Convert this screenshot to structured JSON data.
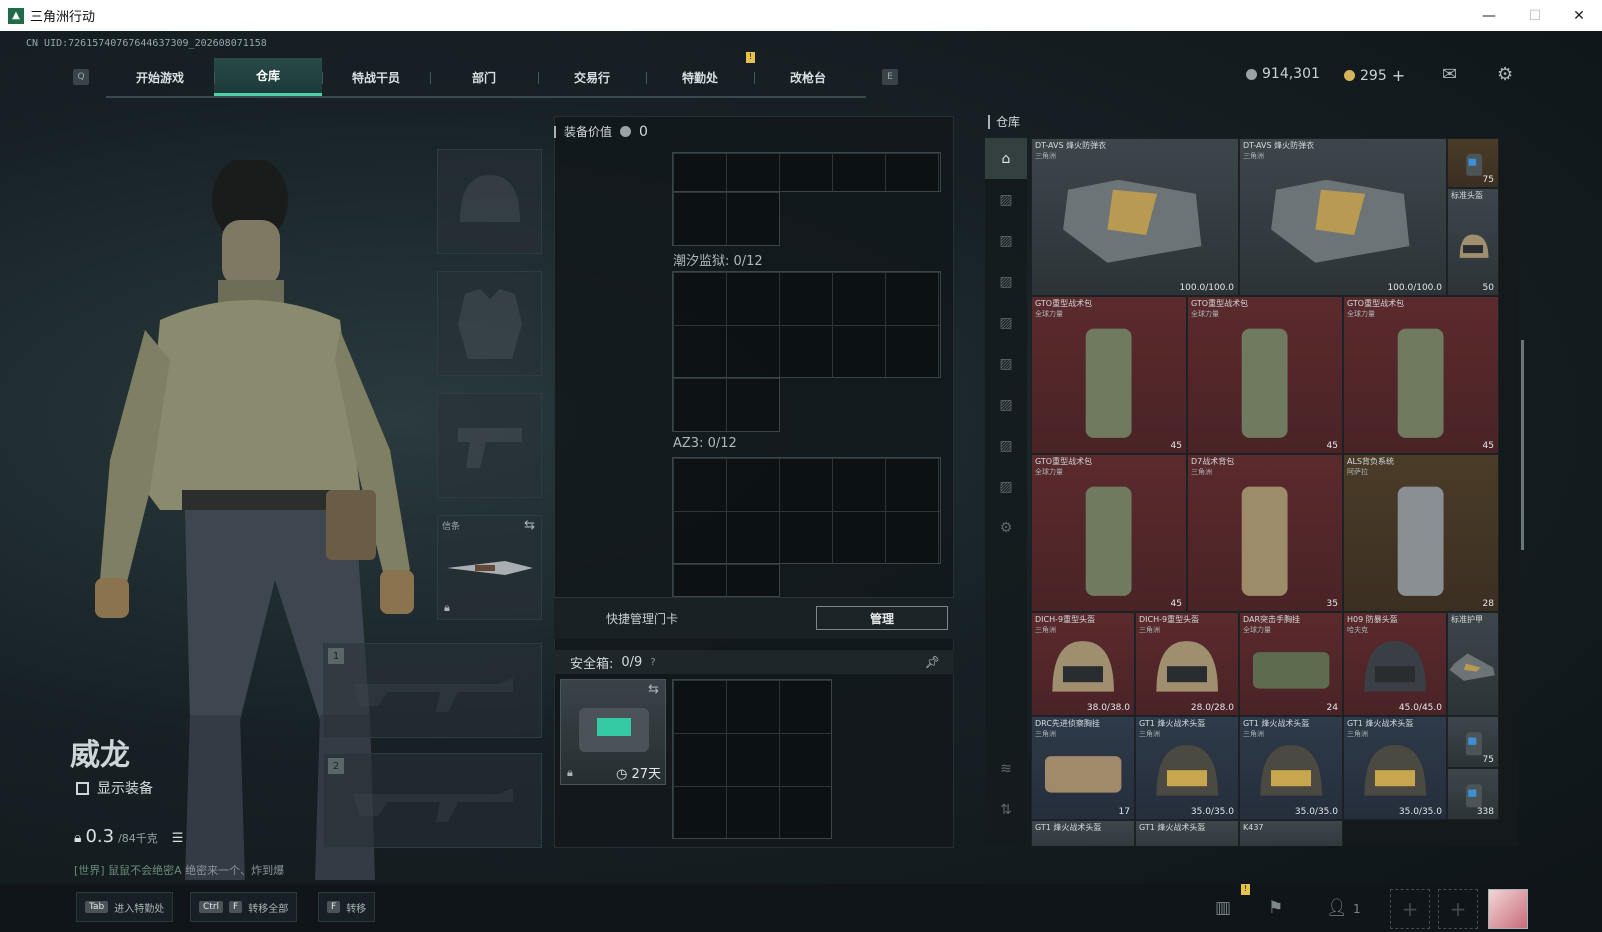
{
  "window": {
    "title": "三角洲行动",
    "minimize": "—",
    "maximize": "☐",
    "close": "✕"
  },
  "uid": "CN UID:72615740767644637309_202608071158",
  "nav": {
    "left_key": "Q",
    "right_key": "E",
    "tabs": [
      "开始游戏",
      "仓库",
      "特战干员",
      "部门",
      "交易行",
      "特勤处",
      "改枪台"
    ],
    "active_tab": "仓库"
  },
  "currency": {
    "silver": "914,301",
    "gold": "295",
    "add": "+"
  },
  "character": {
    "name": "威龙",
    "show_equipment": "显示装备",
    "weight": "0.3",
    "weight_max": "/84千克"
  },
  "chat": {
    "channel": "[世界] 鼠鼠不会绝密A",
    "message": "绝密来一个、炸到爆"
  },
  "slots": {
    "melee_label": "信条",
    "slot1": "1",
    "slot2": "2"
  },
  "middle": {
    "equip_value_label": "装备价值",
    "equip_value": "0",
    "container1": "潮汐监狱: 0/12",
    "container2": "AZ3: 0/12",
    "quick_card": "快捷管理门卡",
    "manage": "管理",
    "safe_label": "安全箱:",
    "safe_count": "0/9",
    "safe_help": "?",
    "safe_days": "27天"
  },
  "warehouse": {
    "title": "仓库",
    "items": [
      {
        "name": "DT-AVS 烽火防弹衣",
        "sub": "三角洲",
        "value": "100.0/100.0",
        "bg": "gray"
      },
      {
        "name": "DT-AVS 烽火防弹衣",
        "sub": "三角洲",
        "value": "100.0/100.0",
        "bg": "gray"
      },
      {
        "name": "",
        "sub": "",
        "value": "75",
        "bg": "gold"
      },
      {
        "name": "标准头盔",
        "sub": "",
        "value": "50",
        "bg": "gray"
      },
      {
        "name": "GTO重型战术包",
        "sub": "全球力量",
        "value": "45",
        "bg": "red"
      },
      {
        "name": "GTO重型战术包",
        "sub": "全球力量",
        "value": "45",
        "bg": "red"
      },
      {
        "name": "GTO重型战术包",
        "sub": "全球力量",
        "value": "45",
        "bg": "red"
      },
      {
        "name": "GTO重型战术包",
        "sub": "全球力量",
        "value": "45",
        "bg": "red"
      },
      {
        "name": "D7战术背包",
        "sub": "三角洲",
        "value": "35",
        "bg": "red"
      },
      {
        "name": "ALS背负系统",
        "sub": "阿萨拉",
        "value": "28",
        "bg": "gold"
      },
      {
        "name": "DICH-9重型头盔",
        "sub": "三角洲",
        "value": "38.0/38.0",
        "bg": "red"
      },
      {
        "name": "DICH-9重型头盔",
        "sub": "三角洲",
        "value": "28.0/28.0",
        "bg": "red"
      },
      {
        "name": "DAR突击手胸挂",
        "sub": "全球力量",
        "value": "24",
        "bg": "red"
      },
      {
        "name": "H09 防暴头盔",
        "sub": "哈夫克",
        "value": "45.0/45.0",
        "bg": "red"
      },
      {
        "name": "标准护甲",
        "sub": "",
        "value": "",
        "bg": "gray"
      },
      {
        "name": "DRC先进侦察胸挂",
        "sub": "三角洲",
        "value": "17",
        "bg": "blue"
      },
      {
        "name": "GT1 烽火战术头盔",
        "sub": "三角洲",
        "value": "35.0/35.0",
        "bg": "blue"
      },
      {
        "name": "GT1 烽火战术头盔",
        "sub": "三角洲",
        "value": "35.0/35.0",
        "bg": "blue"
      },
      {
        "name": "GT1 烽火战术头盔",
        "sub": "三角洲",
        "value": "35.0/35.0",
        "bg": "blue"
      },
      {
        "name": "",
        "sub": "",
        "value": "75",
        "bg": "gray"
      },
      {
        "name": "",
        "sub": "",
        "value": "338",
        "bg": "gray"
      }
    ],
    "partial_row": [
      "GT1 烽火战术头盔",
      "GT1 烽火战术头盔",
      "K437"
    ]
  },
  "bottom": {
    "hint1_key": "Tab",
    "hint1": "进入特勤处",
    "hint2_key1": "Ctrl",
    "hint2_key2": "F",
    "hint2": "转移全部",
    "hint3_key": "F",
    "hint3": "转移",
    "squad_count": "1"
  }
}
